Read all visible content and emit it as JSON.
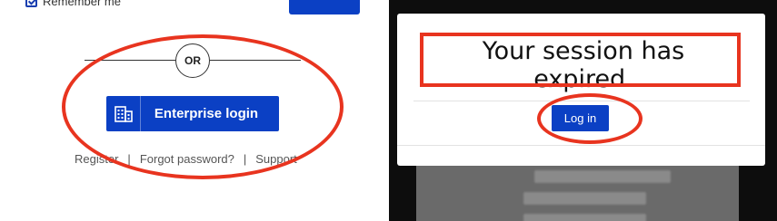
{
  "left_panel": {
    "remember_me": {
      "label": "Remember me",
      "checked": true
    },
    "divider_text": "OR",
    "enterprise_button": {
      "label": "Enterprise login",
      "icon": "building-icon"
    },
    "footer_links": [
      "Register",
      "Forgot password?",
      "Support"
    ],
    "separator": "|"
  },
  "right_panel": {
    "modal": {
      "message": "Your session has expired.",
      "login_button": "Log in"
    }
  },
  "colors": {
    "primary_blue": "#0b40c4",
    "annotation_red": "#e8341f",
    "overlay_dark": "#0d0d0d"
  }
}
